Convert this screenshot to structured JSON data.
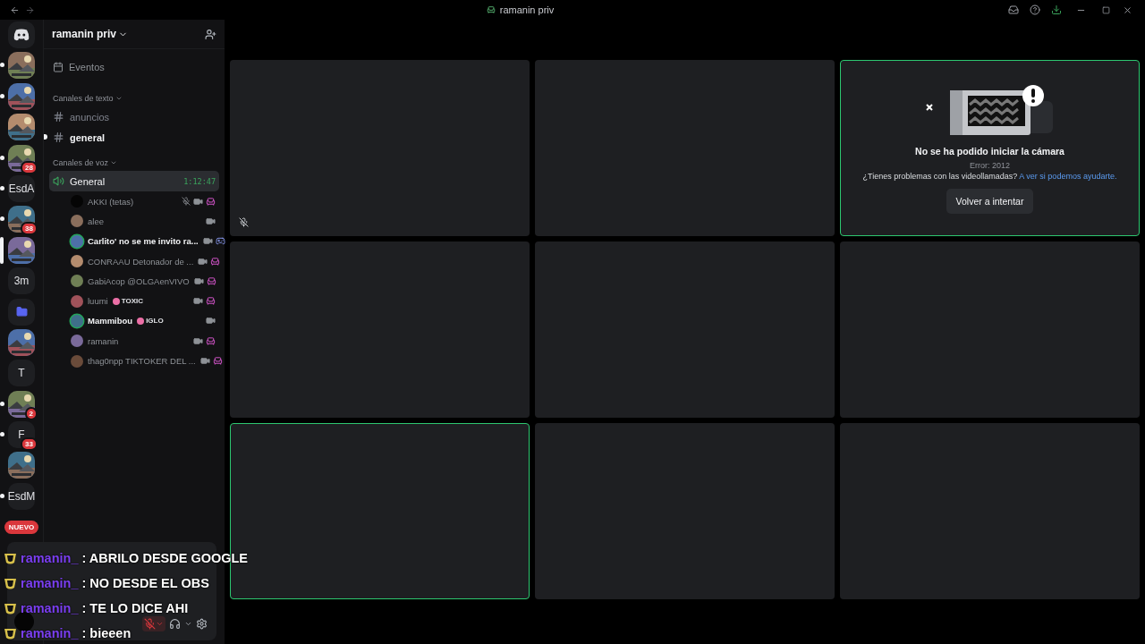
{
  "title_bar": {
    "title": "ramanin priv"
  },
  "servers": [
    {
      "kind": "logo",
      "unread": false,
      "selected": false
    },
    {
      "kind": "picture",
      "unread": true,
      "selected": false
    },
    {
      "kind": "picture",
      "unread": true,
      "selected": false
    },
    {
      "kind": "picture",
      "unread": false,
      "selected": false
    },
    {
      "kind": "picture",
      "unread": true,
      "selected": false,
      "badge": "28"
    },
    {
      "kind": "text",
      "label": "EsdA",
      "unread": true,
      "selected": false
    },
    {
      "kind": "picture",
      "unread": true,
      "selected": false,
      "badge": "38"
    },
    {
      "kind": "picture",
      "unread": false,
      "selected": true
    },
    {
      "kind": "text",
      "label": "3m",
      "unread": false,
      "selected": false
    },
    {
      "kind": "folder",
      "unread": false,
      "selected": false
    },
    {
      "kind": "picture",
      "unread": false,
      "selected": false
    },
    {
      "kind": "text",
      "label": "T",
      "unread": false,
      "selected": false
    },
    {
      "kind": "picture",
      "unread": true,
      "selected": false,
      "badge": "2"
    },
    {
      "kind": "text",
      "label": "F",
      "unread": true,
      "selected": false,
      "badge": "33"
    },
    {
      "kind": "picture",
      "unread": false,
      "selected": false
    },
    {
      "kind": "text",
      "label": "EsdM",
      "unread": true,
      "selected": false
    },
    {
      "kind": "new",
      "label": "NUEVO",
      "unread": false,
      "selected": false
    }
  ],
  "sidebar": {
    "server_name": "ramanin priv",
    "events": "Eventos",
    "text_category": "Canales de texto",
    "text_channels": [
      {
        "name": "anuncios",
        "unread": false
      },
      {
        "name": "general",
        "unread": true
      }
    ],
    "voice_category": "Canales de voz",
    "voice_channel": {
      "name": "General",
      "selected": true,
      "timer": "1:12:47",
      "members": [
        {
          "name": "AKKI (tetas)",
          "kind": "app_activity",
          "speaking": false,
          "muted": true,
          "video": true
        },
        {
          "name": "alee",
          "kind": "plain",
          "speaking": false,
          "muted": false,
          "video": true
        },
        {
          "name": "Carlito' no se me invito ra...",
          "kind": "game_activity",
          "speaking": true,
          "muted": false,
          "video": true
        },
        {
          "name": "CONRAAU Detonador de ...",
          "kind": "app_activity",
          "speaking": false,
          "muted": false,
          "video": true
        },
        {
          "name": "GabiAcop @OLGAenVIVO",
          "kind": "app_activity",
          "speaking": false,
          "muted": false,
          "video": true
        },
        {
          "name": "luumi",
          "tag": "TOXIC",
          "kind": "app_activity",
          "speaking": false,
          "muted": false,
          "video": true
        },
        {
          "name": "Mammibou",
          "tag": "IGLO",
          "kind": "plain",
          "speaking": true,
          "muted": false,
          "video": true
        },
        {
          "name": "ramanin",
          "kind": "app_activity",
          "speaking": false,
          "muted": false,
          "video": true
        },
        {
          "name": "thag0npp TIKTOKER DEL ...",
          "kind": "app_activity",
          "speaking": false,
          "muted": false,
          "video": true
        }
      ]
    }
  },
  "tiles": [
    {
      "kind": "blank",
      "speaking": false,
      "muted": true
    },
    {
      "kind": "blank",
      "speaking": false,
      "muted": false
    },
    {
      "kind": "error",
      "speaking": true,
      "muted": false,
      "title": "No se ha podido iniciar la cámara",
      "error": "Error: 2012",
      "help": "¿Tienes problemas con las videollamadas?",
      "link": "A ver si podemos ayudarte.",
      "button": "Volver a intentar"
    },
    {
      "kind": "blank",
      "speaking": false,
      "muted": false
    },
    {
      "kind": "blank",
      "speaking": false,
      "muted": false
    },
    {
      "kind": "blank",
      "speaking": false,
      "muted": false
    },
    {
      "kind": "blank",
      "speaking": true,
      "muted": false
    },
    {
      "kind": "blank",
      "speaking": false,
      "muted": false
    },
    {
      "kind": "blank",
      "speaking": false,
      "muted": false
    }
  ],
  "user_panel": {
    "mic_muted": true
  },
  "chat_overlay": [
    {
      "user": "ramanin_",
      "text": ": ABRILO DESDE GOOGLE"
    },
    {
      "user": "ramanin_",
      "text": ": NO DESDE EL OBS"
    },
    {
      "user": "ramanin_",
      "text": ": TE LO DICE AHI"
    },
    {
      "user": "ramanin_",
      "text": ": bieeen"
    }
  ]
}
